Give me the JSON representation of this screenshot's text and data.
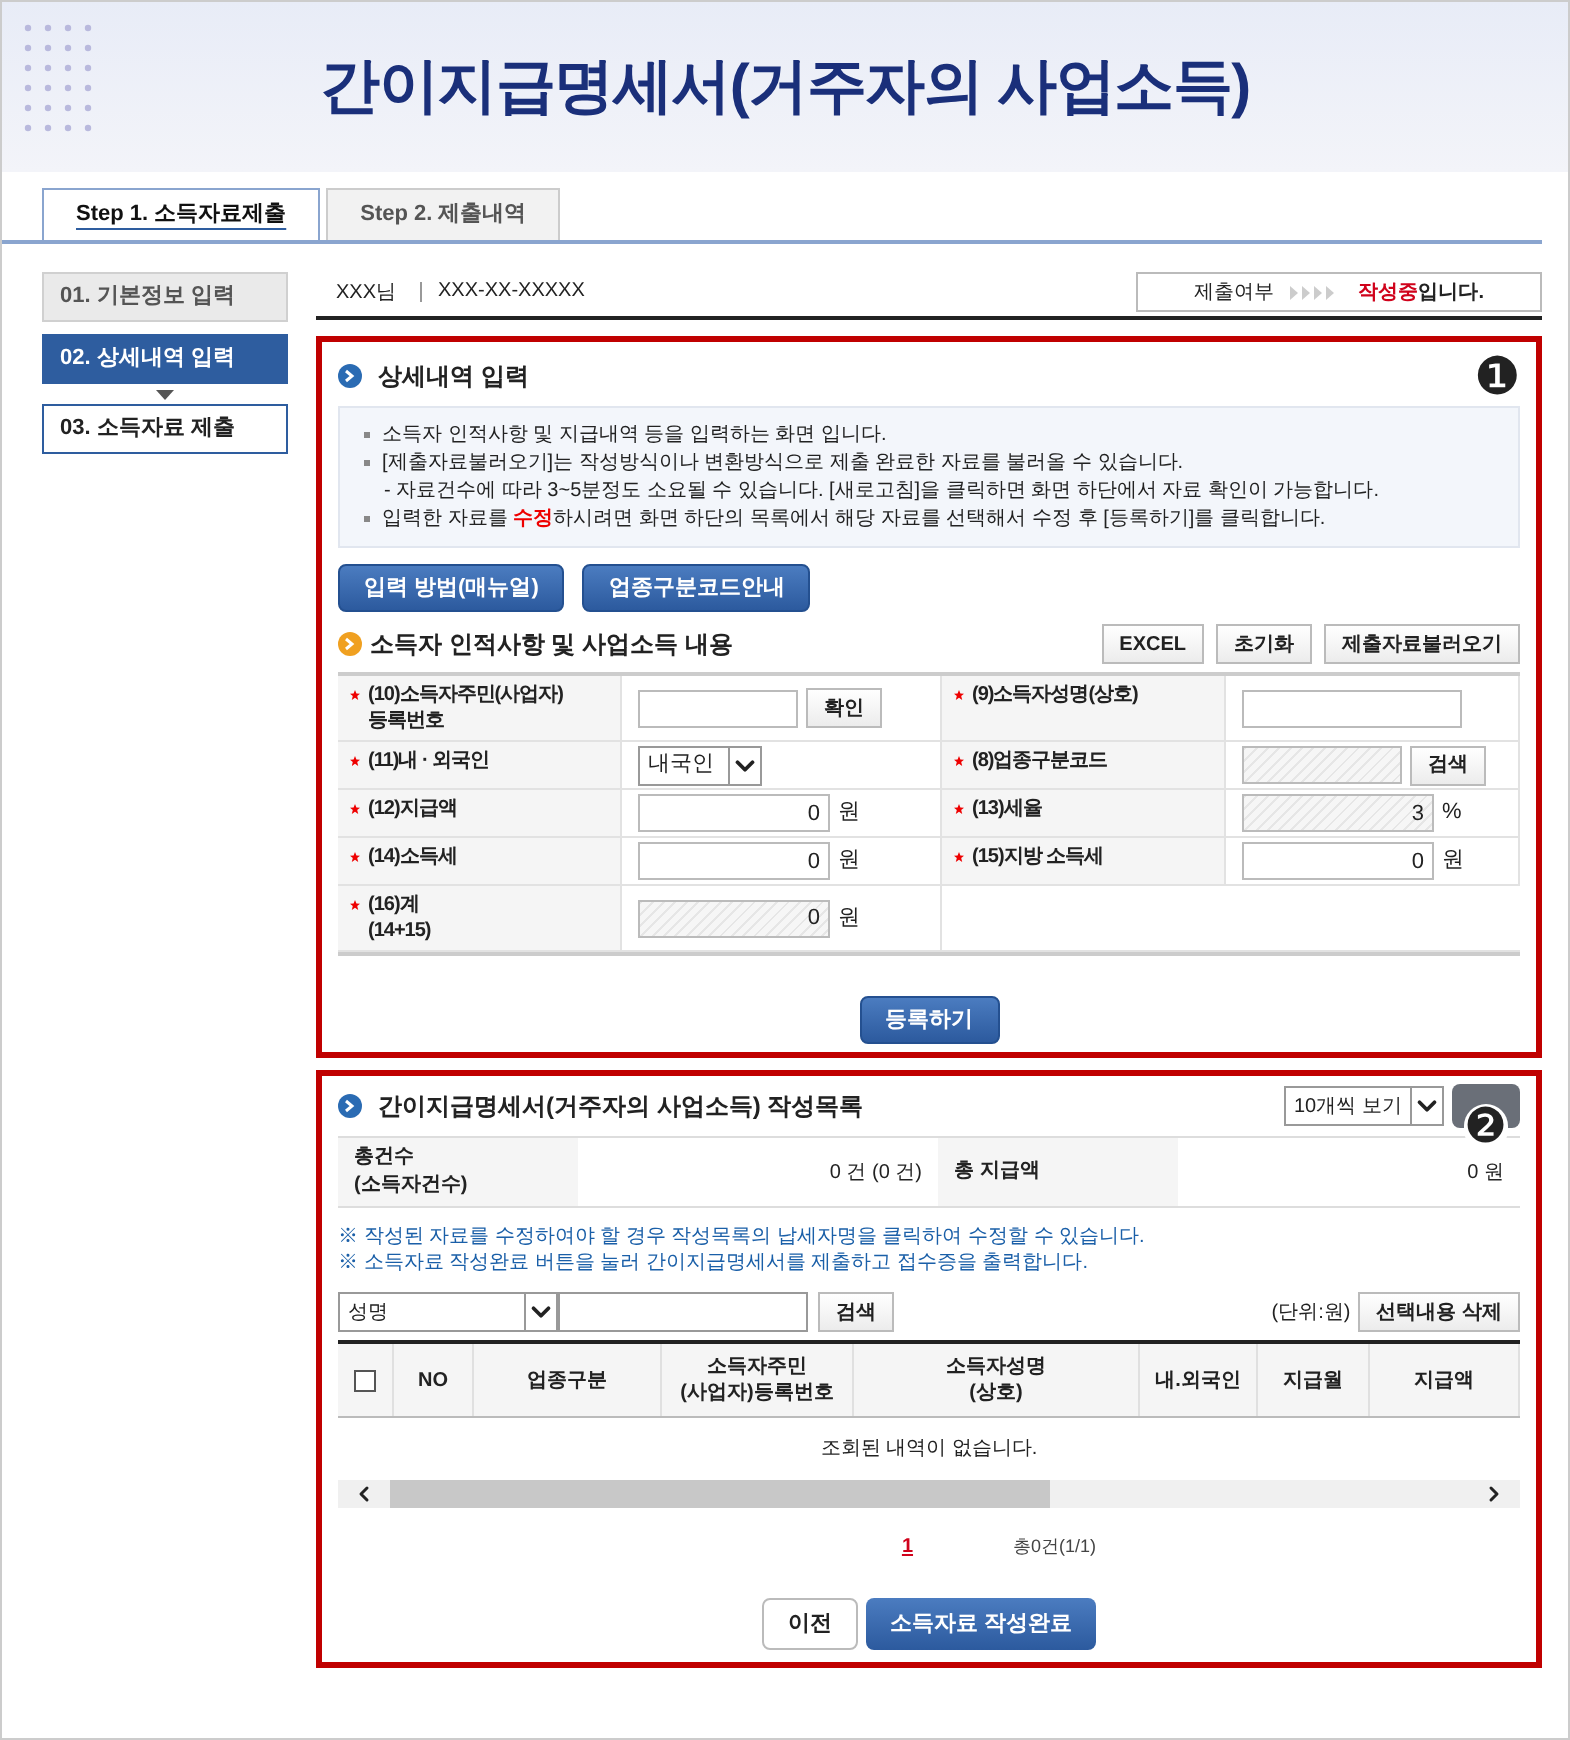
{
  "header": {
    "title": "간이지급명세서(거주자의 사업소득)"
  },
  "tabs": [
    {
      "label": "Step 1. 소득자료제출",
      "selected": true
    },
    {
      "label": "Step 2. 제출내역",
      "selected": false
    }
  ],
  "steps": [
    {
      "label": "01. 기본정보 입력",
      "kind": "done"
    },
    {
      "label": "02. 상세내역 입력",
      "kind": "current"
    },
    {
      "label": "03. 소득자료 제출",
      "kind": "pending"
    }
  ],
  "user": {
    "name": "XXX님",
    "id": "XXX-XX-XXXXX"
  },
  "status": {
    "label": "제출여부",
    "value": "작성중",
    "suffix": "입니다."
  },
  "detail": {
    "title": "상세내역 입력",
    "marker": "❶",
    "notes": [
      {
        "text": "소득자 인적사항 및 지급내역 등을 입력하는 화면 입니다.",
        "kind": "bullet"
      },
      {
        "text": "[제출자료불러오기]는 작성방식이나 변환방식으로 제출 완료한 자료를 불러올 수 있습니다.",
        "kind": "bullet"
      },
      {
        "text": "- 자료건수에 따라 3~5분정도 소요될 수 있습니다. [새로고침]을 클릭하면 화면 하단에서 자료 확인이 가능합니다.",
        "kind": "sub"
      },
      {
        "text": "입력한 자료를 **수정**하시려면 화면 하단의 목록에서 해당 자료를 선택해서 수정 후 [등록하기]를 클릭합니다.",
        "kind": "bullet"
      }
    ],
    "guide_buttons": [
      "입력 방법(매뉴얼)",
      "업종구분코드안내"
    ],
    "form_title": "소득자 인적사항 및 사업소득 내용",
    "form_buttons": [
      "EXCEL",
      "초기화",
      "제출자료불러오기"
    ],
    "rows": [
      [
        {
          "label": "(10)소득자주민(사업자)\n등록번호",
          "required": true,
          "kind": "input",
          "disabled": false,
          "button": "확인"
        },
        {
          "label": "(9)소득자성명(상호)",
          "required": true,
          "kind": "input",
          "disabled": false
        }
      ],
      [
        {
          "label": "(11)내 · 외국인",
          "required": true,
          "kind": "select",
          "value": "내국인"
        },
        {
          "label": "(8)업종구분코드",
          "required": true,
          "kind": "input",
          "disabled": true,
          "button": "검색"
        }
      ],
      [
        {
          "label": "(12)지급액",
          "required": true,
          "kind": "input",
          "disabled": false,
          "value": "0",
          "unit": "원"
        },
        {
          "label": "(13)세율",
          "required": true,
          "kind": "input",
          "disabled": true,
          "value": "3",
          "unit": "%"
        }
      ],
      [
        {
          "label": "(14)소득세",
          "required": true,
          "kind": "input",
          "disabled": false,
          "value": "0",
          "unit": "원"
        },
        {
          "label": "(15)지방 소득세",
          "required": true,
          "kind": "input",
          "disabled": false,
          "value": "0",
          "unit": "원"
        }
      ],
      [
        {
          "label": "(16)계\n(14+15)",
          "required": true,
          "kind": "input",
          "disabled": true,
          "value": "0",
          "unit": "원"
        }
      ]
    ],
    "submit": "등록하기"
  },
  "list": {
    "title": "간이지급명세서(거주자의 사업소득) 작성목록",
    "page_size": "10개씩 보기",
    "marker": "❷",
    "summary": [
      {
        "label": "총건수\n(소득자건수)",
        "value": "0 건 (0 건)"
      },
      {
        "label": "총 지급액",
        "value": "0 원"
      }
    ],
    "notes": [
      "※ 작성된 자료를 수정하여야 할 경우 작성목록의 납세자명을 클릭하여 수정할 수 있습니다.",
      "※ 소득자료 작성완료 버튼을 눌러 간이지급명세서를 제출하고 접수증을 출력합니다."
    ],
    "search_field": "성명",
    "search_button": "검색",
    "unit": "(단위:원)",
    "delete_button": "선택내용 삭제",
    "select_all": false,
    "columns": [
      "NO",
      "업종구분",
      "소득자주민\n(사업자)등록번호",
      "소득자성명\n(상호)",
      "내.외국인",
      "지급월",
      "지급액"
    ],
    "empty": "조회된 내역이 없습니다.",
    "pages": [
      {
        "label": "1",
        "selected": true
      }
    ],
    "total": "총0건(1/1)",
    "buttons": [
      {
        "label": "이전",
        "kind": "secondary"
      },
      {
        "label": "소득자료 작성완료",
        "kind": "primary"
      }
    ]
  }
}
